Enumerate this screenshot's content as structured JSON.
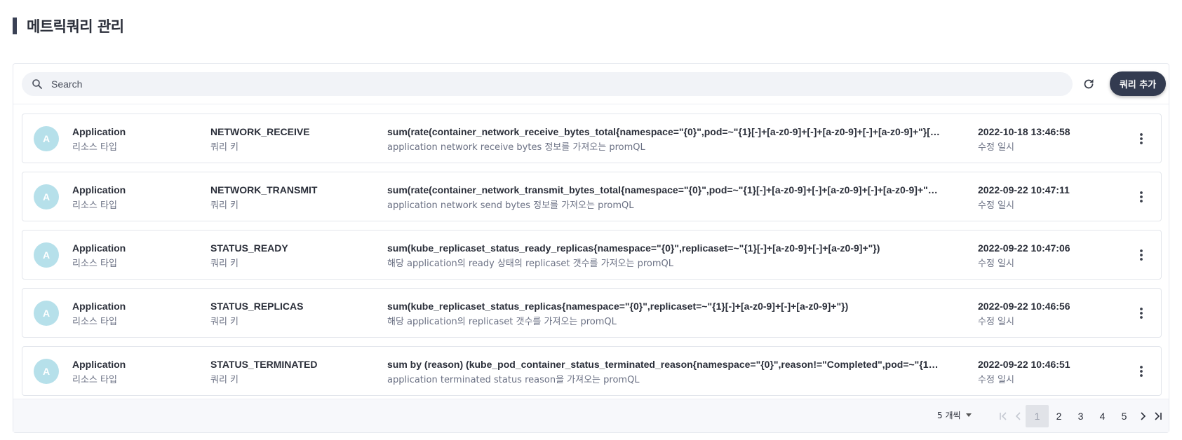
{
  "page": {
    "title": "메트릭쿼리 관리"
  },
  "toolbar": {
    "search_placeholder": "Search",
    "add_label": "쿼리 추가"
  },
  "list": {
    "rows": [
      {
        "avatar": "A",
        "type": "Application",
        "type_label": "리소스 타입",
        "key": "NETWORK_RECEIVE",
        "key_label": "쿼리 키",
        "query": "sum(rate(container_network_receive_bytes_total{namespace=\"{0}\",pod=~\"{1}[-]+[a-z0-9]+[-]+[a-z0-9]+[-]+[a-z0-9]+\"}[5…",
        "description": "application network receive bytes 정보를 가져오는 promQL",
        "date": "2022-10-18 13:46:58",
        "date_label": "수정 일시"
      },
      {
        "avatar": "A",
        "type": "Application",
        "type_label": "리소스 타입",
        "key": "NETWORK_TRANSMIT",
        "key_label": "쿼리 키",
        "query": "sum(rate(container_network_transmit_bytes_total{namespace=\"{0}\",pod=~\"{1}[-]+[a-z0-9]+[-]+[a-z0-9]+[-]+[a-z0-9]+\"}[…",
        "description": "application network send bytes 정보를 가져오는 promQL",
        "date": "2022-09-22 10:47:11",
        "date_label": "수정 일시"
      },
      {
        "avatar": "A",
        "type": "Application",
        "type_label": "리소스 타입",
        "key": "STATUS_READY",
        "key_label": "쿼리 키",
        "query": "sum(kube_replicaset_status_ready_replicas{namespace=\"{0}\",replicaset=~\"{1}[-]+[a-z0-9]+[-]+[a-z0-9]+\"})",
        "description": "해당 application의 ready 상태의 replicaset 갯수를 가져오는 promQL",
        "date": "2022-09-22 10:47:06",
        "date_label": "수정 일시"
      },
      {
        "avatar": "A",
        "type": "Application",
        "type_label": "리소스 타입",
        "key": "STATUS_REPLICAS",
        "key_label": "쿼리 키",
        "query": "sum(kube_replicaset_status_replicas{namespace=\"{0}\",replicaset=~\"{1}[-]+[a-z0-9]+[-]+[a-z0-9]+\"})",
        "description": "해당 application의 replicaset 갯수를 가져오는 promQL",
        "date": "2022-09-22 10:46:56",
        "date_label": "수정 일시"
      },
      {
        "avatar": "A",
        "type": "Application",
        "type_label": "리소스 타입",
        "key": "STATUS_TERMINATED",
        "key_label": "쿼리 키",
        "query": "sum by (reason) (kube_pod_container_status_terminated_reason{namespace=\"{0}\",reason!=\"Completed\",pod=~\"{1}[-]…",
        "description": "application terminated status reason을 가져오는 promQL",
        "date": "2022-09-22 10:46:51",
        "date_label": "수정 일시"
      }
    ]
  },
  "pagination": {
    "page_size_label": "5 개씩",
    "pages": [
      "1",
      "2",
      "3",
      "4",
      "5"
    ],
    "current_page": "1"
  },
  "icons": {
    "search": "search-icon",
    "refresh": "refresh-icon",
    "more": "more-vertical-icon",
    "first": "first-page-icon",
    "prev": "chevron-left-icon",
    "next": "chevron-right-icon",
    "last": "last-page-icon"
  },
  "colors": {
    "accent": "#333b50",
    "avatar": "#b6e0ea",
    "title_bar": "#3a4155"
  }
}
